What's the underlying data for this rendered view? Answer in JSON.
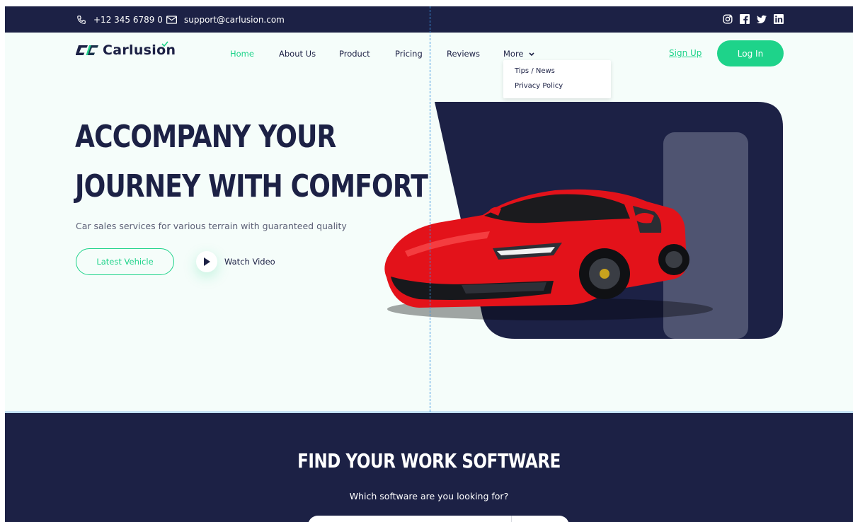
{
  "topbar": {
    "phone": "+12 345 6789 0",
    "email": "support@carlusion.com",
    "social_icons": [
      "instagram-icon",
      "facebook-icon",
      "twitter-icon",
      "linkedin-icon"
    ]
  },
  "brand": {
    "name": "Carlusion"
  },
  "nav": {
    "items": [
      {
        "label": "Home",
        "active": true
      },
      {
        "label": "About Us"
      },
      {
        "label": "Product"
      },
      {
        "label": "Pricing"
      },
      {
        "label": "Reviews"
      },
      {
        "label": "More"
      }
    ],
    "more_dropdown": [
      "Tips / News",
      "Privacy Policy"
    ],
    "signup": "Sign Up",
    "login": "Log In"
  },
  "hero": {
    "title_line1": "ACCOMPANY YOUR",
    "title_line2": "JOURNEY WITH COMFORT",
    "subtitle": "Car sales services for various terrain with guaranteed quality",
    "primary_button": "Latest Vehicle",
    "video_button": "Watch Video"
  },
  "find_section": {
    "title": "FIND YOUR WORK SOFTWARE",
    "subtitle": "Which software are you looking for?"
  },
  "colors": {
    "navy": "#1c2145",
    "accent": "#1ed38a",
    "car_red": "#e3121a",
    "background": "#f5fdfa"
  }
}
